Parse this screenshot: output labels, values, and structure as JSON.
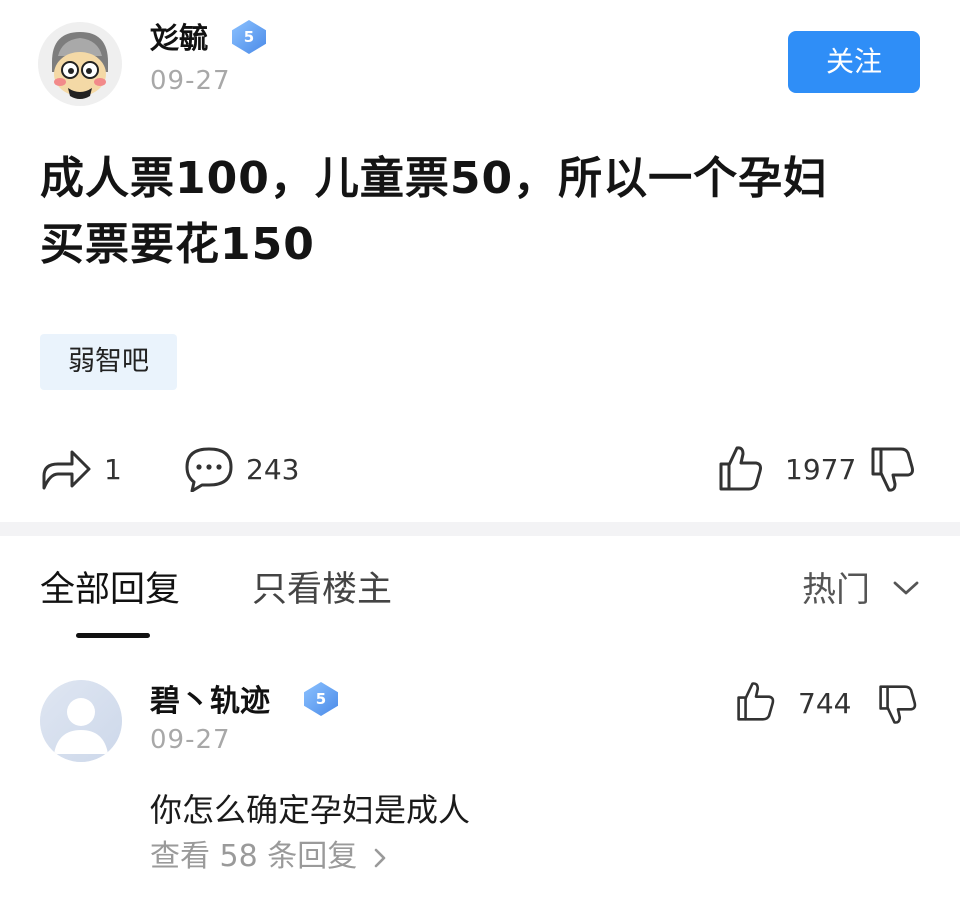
{
  "post": {
    "author": {
      "name": "彣毓",
      "level": "5",
      "avatar": "cartoon-avatar"
    },
    "date": "09-27",
    "follow_label": "关注",
    "content_line1": "成人票100，儿童票50，所以一个孕妇",
    "content_line2": "买票要花150",
    "tag": "弱智吧",
    "actions": {
      "share_count": "1",
      "comment_count": "243",
      "like_count": "1977"
    }
  },
  "tabs": {
    "all_replies": "全部回复",
    "op_only": "只看楼主",
    "sort": "热门"
  },
  "comment": {
    "author": {
      "name": "碧丶轨迹",
      "level": "5",
      "avatar": "default-avatar"
    },
    "date": "09-27",
    "text": "你怎么确定孕妇是成人",
    "like_count": "744",
    "view_replies": "查看 58 条回复"
  },
  "colors": {
    "accent": "#2f8ef7",
    "muted": "#a8a8a8",
    "tag_bg": "#eaf3fc"
  }
}
